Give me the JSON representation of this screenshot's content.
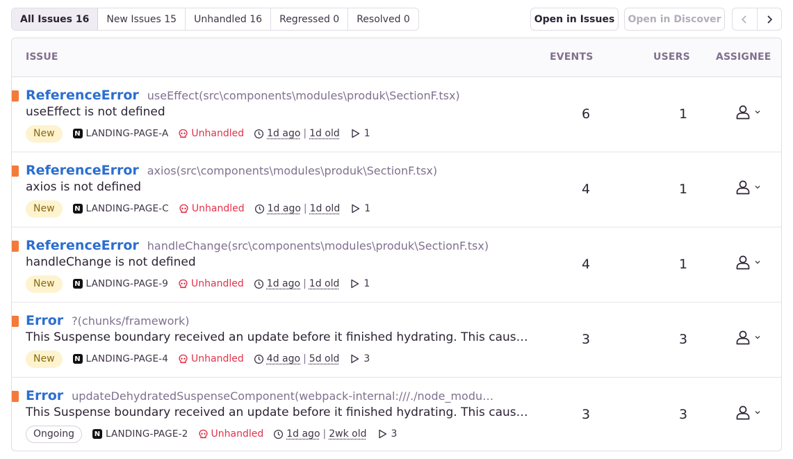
{
  "tabs": [
    {
      "label": "All Issues 16",
      "active": true
    },
    {
      "label": "New Issues 15",
      "active": false
    },
    {
      "label": "Unhandled 16",
      "active": false
    },
    {
      "label": "Regressed 0",
      "active": false
    },
    {
      "label": "Resolved 0",
      "active": false
    }
  ],
  "actions": {
    "open_in_issues": "Open in Issues",
    "open_in_discover": "Open in Discover"
  },
  "table": {
    "headers": {
      "issue": "ISSUE",
      "events": "EVENTS",
      "users": "USERS",
      "assignee": "ASSIGNEE"
    },
    "rows": [
      {
        "type": "ReferenceError",
        "culprit": "useEffect(src\\components\\modules\\produk\\SectionF.tsx)",
        "message": "useEffect is not defined",
        "status": "New",
        "project": "LANDING-PAGE-A",
        "handled": "Unhandled",
        "last_seen": "1d ago",
        "first_seen": "1d old",
        "replays": "1",
        "events": "6",
        "users": "1"
      },
      {
        "type": "ReferenceError",
        "culprit": "axios(src\\components\\modules\\produk\\SectionF.tsx)",
        "message": "axios is not defined",
        "status": "New",
        "project": "LANDING-PAGE-C",
        "handled": "Unhandled",
        "last_seen": "1d ago",
        "first_seen": "1d old",
        "replays": "1",
        "events": "4",
        "users": "1"
      },
      {
        "type": "ReferenceError",
        "culprit": "handleChange(src\\components\\modules\\produk\\SectionF.tsx)",
        "message": "handleChange is not defined",
        "status": "New",
        "project": "LANDING-PAGE-9",
        "handled": "Unhandled",
        "last_seen": "1d ago",
        "first_seen": "1d old",
        "replays": "1",
        "events": "4",
        "users": "1"
      },
      {
        "type": "Error",
        "culprit": "?(chunks/framework)",
        "message": "This Suspense boundary received an update before it finished hydrating. This caus…",
        "status": "New",
        "project": "LANDING-PAGE-4",
        "handled": "Unhandled",
        "last_seen": "4d ago",
        "first_seen": "5d old",
        "replays": "3",
        "events": "3",
        "users": "3"
      },
      {
        "type": "Error",
        "culprit": "updateDehydratedSuspenseComponent(webpack-internal:///./node_modu…",
        "message": "This Suspense boundary received an update before it finished hydrating. This caus…",
        "status": "Ongoing",
        "project": "LANDING-PAGE-2",
        "handled": "Unhandled",
        "last_seen": "1d ago",
        "first_seen": "2wk old",
        "replays": "3",
        "events": "3",
        "users": "3"
      }
    ]
  },
  "icons": {
    "project_logo": "nextjs-logo-icon",
    "handled": "skull-icon",
    "time": "clock-icon",
    "replays": "play-icon",
    "assignee": "user-icon",
    "assignee_dropdown": "chevron-down-icon",
    "prev": "chevron-left-icon",
    "next": "chevron-right-icon"
  },
  "colors": {
    "issue_type": "#2c6ecf",
    "level_marker": "#f47a3a",
    "unhandled": "#e0324b",
    "new_badge_bg": "#fdf3cf"
  }
}
